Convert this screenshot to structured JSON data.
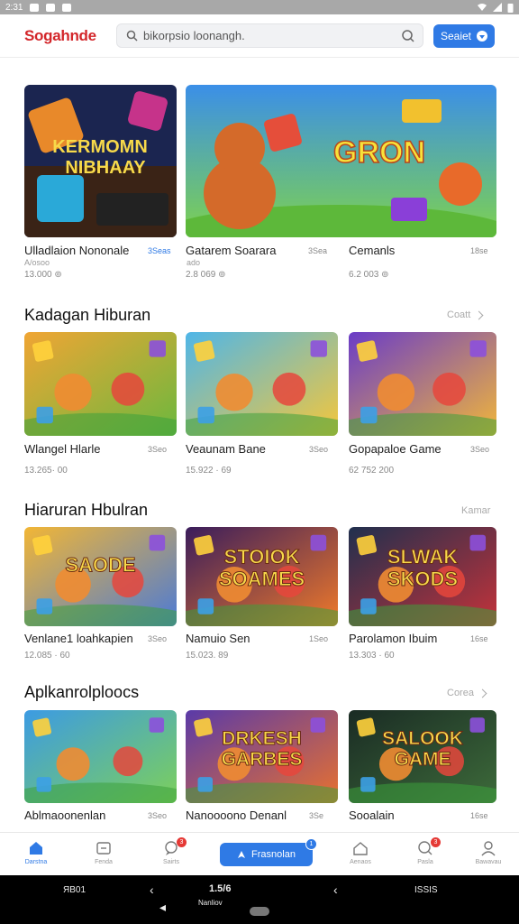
{
  "status": {
    "time": "2:31",
    "icons": [
      "notification-icon",
      "message-icon",
      "game-icon"
    ]
  },
  "header": {
    "brand": "Sogahnde",
    "search_placeholder": "bikorpsio loonangh.",
    "button_label": "Seaiet"
  },
  "featured": [
    {
      "title": "Ulladlaion Nononale",
      "badge": "3Seas",
      "sub": "A/osoo",
      "meta": "13.000 ⊚",
      "art": {
        "bg1": "#1c2a5a",
        "bg2": "#e46a24",
        "text": "KERMOMN NIBHAAY"
      }
    },
    {
      "title": "Gatarem Soarara",
      "badge": "3Sea",
      "sub": "ado",
      "meta": "2.8 069 ⊚",
      "art": {
        "bg1": "#3b8fe8",
        "bg2": "#7ed24f",
        "text": "GRON"
      }
    },
    {
      "title": "Cemanls",
      "badge": "18se",
      "sub": "",
      "meta": "6.2 003 ⊚",
      "art": null
    }
  ],
  "sections": [
    {
      "title": "Kadagan Hiburan",
      "link": "Coatt",
      "items": [
        {
          "title": "Wlangel Hlarle",
          "badge": "3Seo",
          "meta": "13.265· 00",
          "art": {
            "bg1": "#f0a534",
            "bg2": "#6cb83e",
            "text": ""
          }
        },
        {
          "title": "Veaunam Bane",
          "badge": "3Seo",
          "meta": "15.922 · 69",
          "art": {
            "bg1": "#4fb6e8",
            "bg2": "#f5c73a",
            "text": ""
          }
        },
        {
          "title": "Gopapaloe Game",
          "badge": "3Seo",
          "meta": "62 752 200",
          "art": {
            "bg1": "#6a3cc8",
            "bg2": "#f1b63a",
            "text": ""
          }
        }
      ]
    },
    {
      "title": "Hiaruran Hbulran",
      "link": "Kamar",
      "items": [
        {
          "title": "Venlane1 loahkapien",
          "badge": "3Seo",
          "meta": "12.085 · 60",
          "art": {
            "bg1": "#f2b635",
            "bg2": "#4b7ad6",
            "text": "SAODE"
          }
        },
        {
          "title": "Namuio Sen",
          "badge": "1Seo",
          "meta": "15.023. 89",
          "art": {
            "bg1": "#3a1d5c",
            "bg2": "#f07a2a",
            "text": "STOIOK SOAMES"
          }
        },
        {
          "title": "Parolamon Ibuim",
          "badge": "16se",
          "meta": "13.303 · 60",
          "art": {
            "bg1": "#20304e",
            "bg2": "#c4323a",
            "text": "SLWAK SKODS"
          }
        }
      ]
    },
    {
      "title": "Aplkanrolploocs",
      "link": "Corea",
      "items": [
        {
          "title": "Ablmaoonenlan",
          "badge": "3Seo",
          "meta": "",
          "art": {
            "bg1": "#3c9be3",
            "bg2": "#7dd05a",
            "text": ""
          }
        },
        {
          "title": "Nanoooono Denanl",
          "badge": "3Se",
          "meta": "",
          "art": {
            "bg1": "#5a3aa8",
            "bg2": "#e8712f",
            "text": "DRKESH GARBES"
          }
        },
        {
          "title": "Sooalain",
          "badge": "16se",
          "meta": "",
          "art": {
            "bg1": "#1a2b24",
            "bg2": "#3d6b3a",
            "text": "SALOOK GAME"
          }
        }
      ]
    }
  ],
  "bottom_nav": [
    {
      "label": "Darstna",
      "icon": "home-icon",
      "active": true,
      "badge": ""
    },
    {
      "label": "Fenda",
      "icon": "tv-icon",
      "active": false,
      "badge": ""
    },
    {
      "label": "Sairts",
      "icon": "chat-icon",
      "active": false,
      "badge": "3"
    },
    {
      "label": "Aenaos",
      "icon": "house-icon",
      "active": false,
      "badge": ""
    },
    {
      "label": "Pasla",
      "icon": "chat-bubble-icon",
      "active": false,
      "badge": "3"
    },
    {
      "label": "Bawavau",
      "icon": "user-icon",
      "active": false,
      "badge": ""
    }
  ],
  "nav_pill": {
    "label": "Frasnolan",
    "badge": "1"
  },
  "system": {
    "left": "ЯВ01",
    "center_top": "1.5/6",
    "center_bottom": "Nanliov",
    "right": "ISSIS"
  },
  "colors": {
    "accent": "#2f7ae5",
    "brand": "#d3262a",
    "notification": "#e53935"
  }
}
